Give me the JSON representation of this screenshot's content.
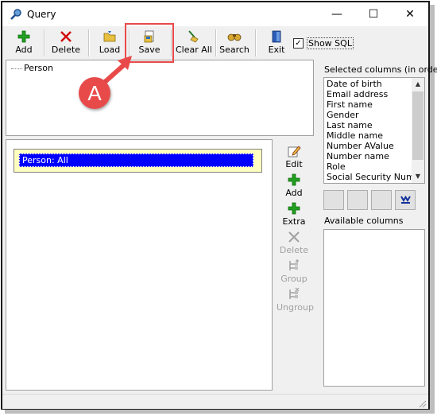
{
  "window": {
    "title": "Query",
    "minimize": "—",
    "maximize": "☐",
    "close": "✕"
  },
  "toolbar": {
    "add": "Add",
    "delete": "Delete",
    "load": "Load",
    "save": "Save",
    "clear_all": "Clear All",
    "search": "Search",
    "exit": "Exit",
    "show_sql": {
      "label": "Show SQL",
      "checked": true,
      "mark": "✓"
    }
  },
  "tree": {
    "root": "Person"
  },
  "query": {
    "condition": "Person: All"
  },
  "side_actions": {
    "edit": "Edit",
    "add": "Add",
    "extra": "Extra",
    "delete": "Delete",
    "group": "Group",
    "ungroup": "Ungroup"
  },
  "columns": {
    "selected_label": "Selected columns (in order)",
    "selected": [
      "Date of birth",
      "Email address",
      "First name",
      "Gender",
      "Last name",
      "Middle name",
      "Number AValue",
      "Number name",
      "Role",
      "Social Security Number"
    ],
    "available_label": "Available columns"
  },
  "annotation": {
    "callout": "A"
  },
  "colors": {
    "accent": "#e84a4a",
    "selection": "#0000ff",
    "condition_bg": "#ffffc0"
  }
}
